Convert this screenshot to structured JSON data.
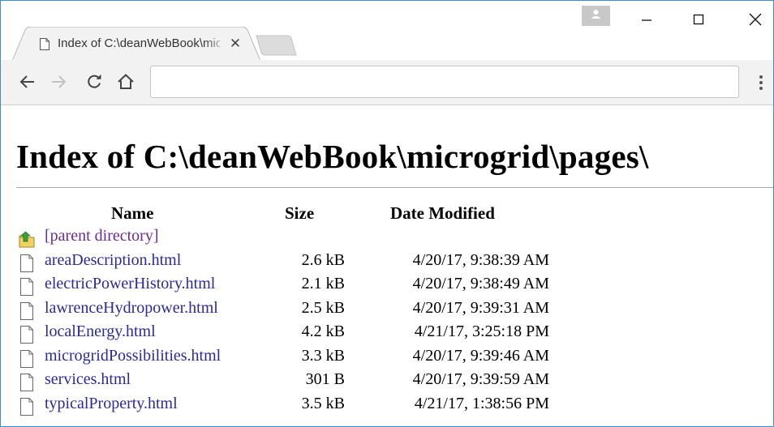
{
  "browser": {
    "tab": {
      "title": "Index of C:\\deanWebBook\\microgrid\\pages\\",
      "close_glyph": "✕"
    },
    "omnibox": {
      "value": ""
    },
    "icons": {
      "back": "back-arrow-icon",
      "forward": "forward-arrow-icon",
      "reload": "reload-icon",
      "home": "home-icon",
      "menu": "more-vert-icon",
      "profile": "profile-icon",
      "minimize": "minimize-icon",
      "maximize": "maximize-icon",
      "close": "close-icon"
    },
    "colors": {
      "link": "#2a2a9c",
      "visited_link": "#6b2b93",
      "toolbar_bg": "#f2f2f2",
      "window_border": "#3a8fd0"
    }
  },
  "page": {
    "heading": "Index of C:\\deanWebBook\\microgrid\\pages\\",
    "columns": {
      "name": "Name",
      "size": "Size",
      "date": "Date Modified"
    },
    "parent_link": "[parent directory]",
    "entries": [
      {
        "name": "areaDescription.html",
        "size": "2.6 kB",
        "date": "4/20/17, 9:38:39 AM"
      },
      {
        "name": "electricPowerHistory.html",
        "size": "2.1 kB",
        "date": "4/20/17, 9:38:49 AM"
      },
      {
        "name": "lawrenceHydropower.html",
        "size": "2.5 kB",
        "date": "4/20/17, 9:39:31 AM"
      },
      {
        "name": "localEnergy.html",
        "size": "4.2 kB",
        "date": "4/21/17, 3:25:18 PM"
      },
      {
        "name": "microgridPossibilities.html",
        "size": "3.3 kB",
        "date": "4/20/17, 9:39:46 AM"
      },
      {
        "name": "services.html",
        "size": "301 B",
        "date": "4/20/17, 9:39:59 AM"
      },
      {
        "name": "typicalProperty.html",
        "size": "3.5 kB",
        "date": "4/21/17, 1:38:56 PM"
      }
    ]
  }
}
